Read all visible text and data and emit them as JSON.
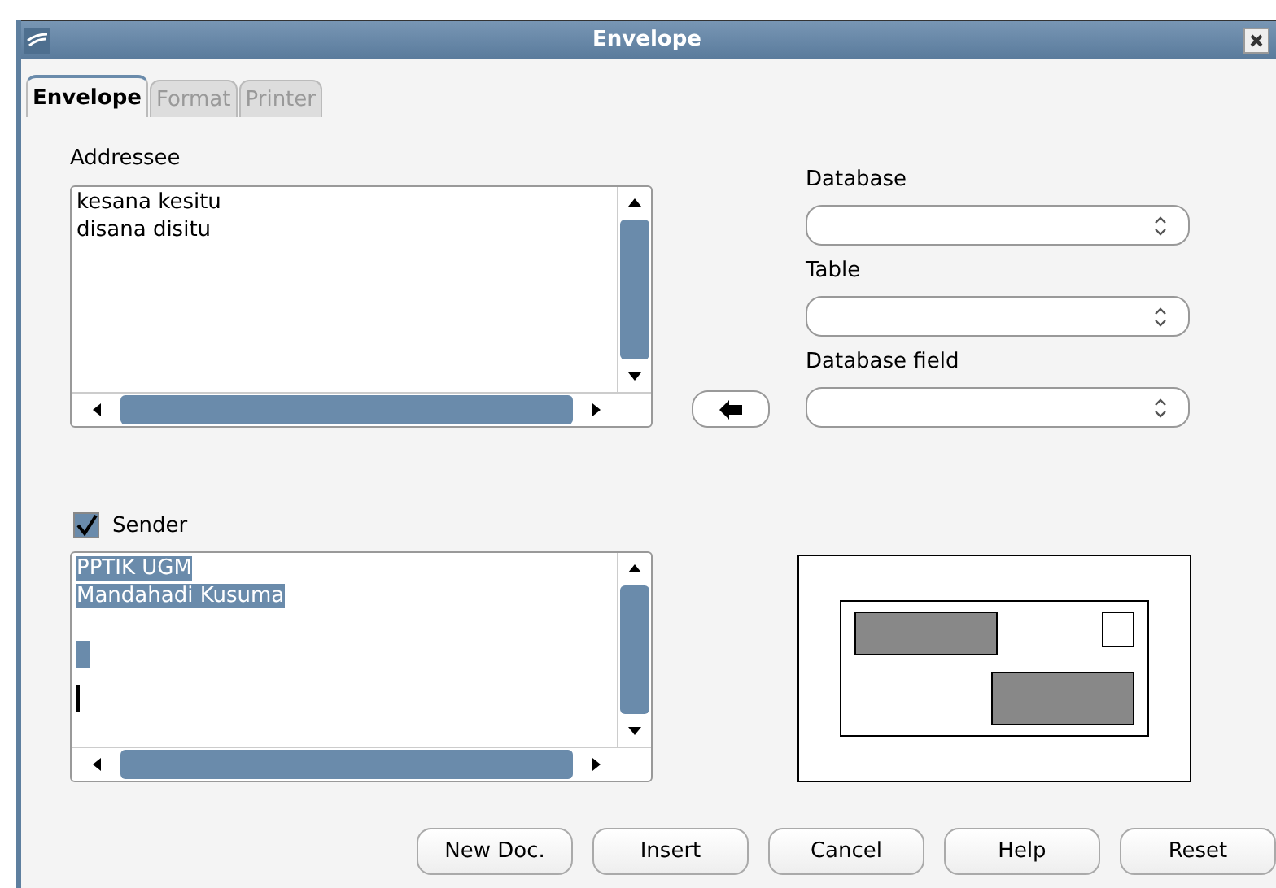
{
  "window": {
    "title": "Envelope"
  },
  "tabs": [
    {
      "label": "Envelope",
      "selected": true
    },
    {
      "label": "Format",
      "selected": false
    },
    {
      "label": "Printer",
      "selected": false
    }
  ],
  "addressee": {
    "label": "Addressee",
    "lines": [
      "kesana kesitu",
      "disana disitu"
    ]
  },
  "database": {
    "label": "Database"
  },
  "table": {
    "label": "Table"
  },
  "database_field": {
    "label": "Database field"
  },
  "sender": {
    "label": "Sender",
    "checked": true,
    "lines": [
      "PPTIK UGM",
      "Mandahadi Kusuma"
    ],
    "selected": true
  },
  "buttons": [
    "New Doc.",
    "Insert",
    "Cancel",
    "Help",
    "Reset"
  ]
}
